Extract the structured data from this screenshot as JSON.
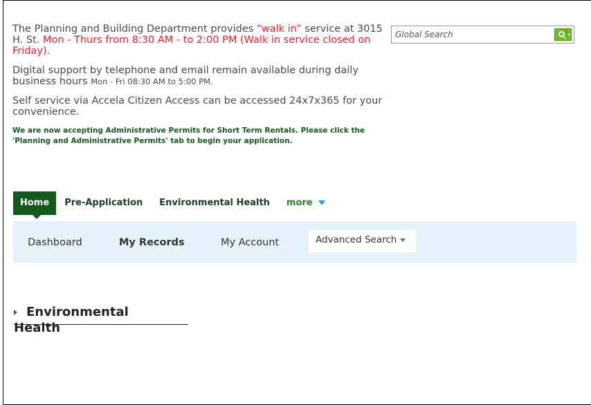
{
  "announcement": {
    "p1_a": "The Planning and Building Department provides ",
    "p1_walkin": "“walk in”",
    "p1_b": " service at 3015 H. St. ",
    "p1_hours": "Mon - Thurs from 8:30 AM - to 2:00 PM (Walk in service closed on Friday).",
    "p2_main": "Digital support by telephone and email remain available during daily business hours ",
    "p2_small": "Mon - Fri  08:30 AM to 5:00 PM.",
    "p3": "Self service via Accela Citizen Access can be accessed 24x7x365 for your convenience.",
    "p4": "We are now accepting Administrative Permits for Short Term Rentals. Please click the 'Planning and Administrative Permits' tab to begin your application."
  },
  "search": {
    "placeholder": "Global Search"
  },
  "tabs": {
    "home": "Home",
    "pre_application": "Pre-Application",
    "environmental_health": "Environmental Health",
    "more": "more"
  },
  "subnav": {
    "dashboard": "Dashboard",
    "my_records": "My Records",
    "my_account": "My Account",
    "advanced_search": "Advanced Search"
  },
  "section": {
    "title_line1": "Environmental",
    "title_line2": "Health"
  }
}
